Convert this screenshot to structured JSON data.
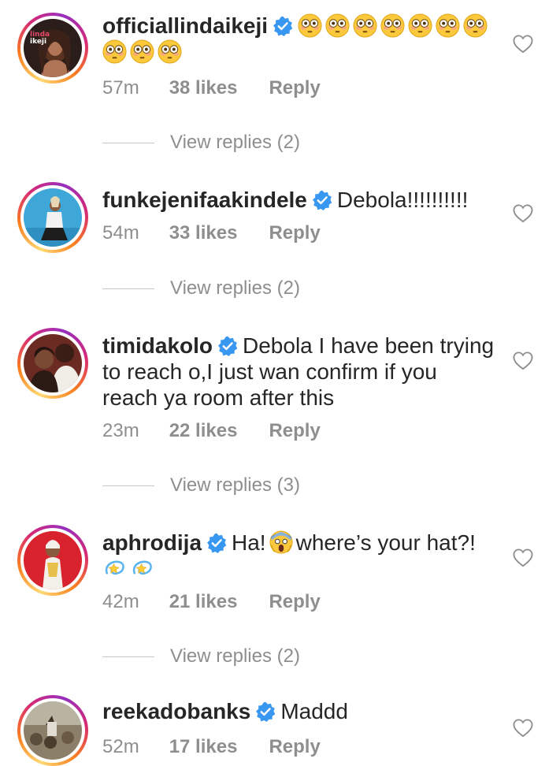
{
  "comments": [
    {
      "username": "officiallindaikeji",
      "text": "",
      "emoji_count": 10,
      "emoji": "flushed-face",
      "time": "57m",
      "likes": "38 likes",
      "reply": "Reply",
      "view_replies": "View replies (2)"
    },
    {
      "username": "funkejenifaakindele",
      "text": "Debola!!!!!!!!!!",
      "time": "54m",
      "likes": "33 likes",
      "reply": "Reply",
      "view_replies": "View replies (2)"
    },
    {
      "username": "timidakolo",
      "text_line1": "Debola I have been trying",
      "text_line2": "to reach o,I just wan confirm if you",
      "text_line3": "reach ya room after this",
      "time": "23m",
      "likes": "22 likes",
      "reply": "Reply",
      "view_replies": "View replies (3)"
    },
    {
      "username": "aphrodija",
      "text_a": "Ha!",
      "text_b": "where’s your hat?!",
      "emoji_a": "screaming-face",
      "emoji_b": "dizzy-symbol",
      "time": "42m",
      "likes": "21 likes",
      "reply": "Reply",
      "view_replies": "View replies (2)"
    },
    {
      "username": "reekadobanks",
      "text": "Maddd",
      "time": "52m",
      "likes": "17 likes",
      "reply": "Reply"
    }
  ],
  "colors": {
    "username": "#262626",
    "meta": "#8e8e8e",
    "verified": "#3897f0",
    "ring": [
      "#feda75",
      "#fa7e1e",
      "#d62976",
      "#962fbf"
    ]
  },
  "icons": [
    "verified-badge-icon",
    "heart-outline-icon",
    "flushed-face-emoji",
    "screaming-face-emoji",
    "dizzy-symbol-emoji"
  ]
}
